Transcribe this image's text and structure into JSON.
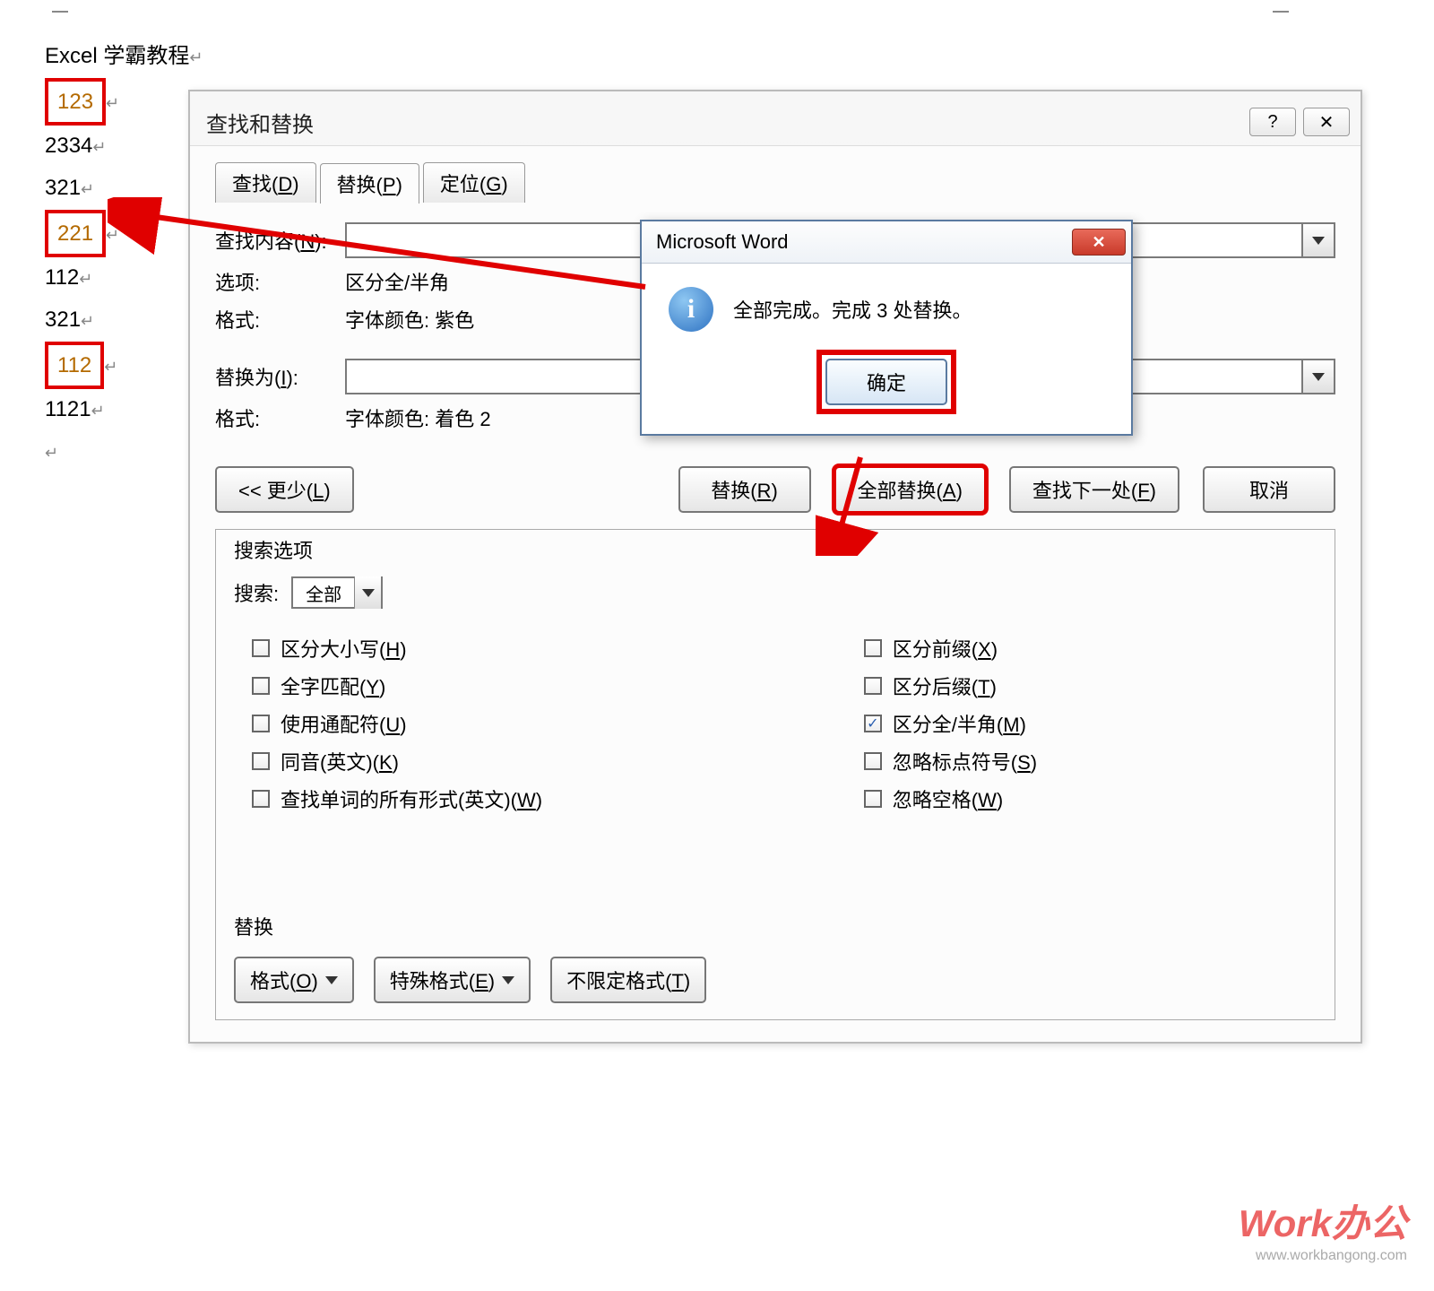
{
  "doc": {
    "title": "Excel 学霸教程",
    "lines": [
      "123",
      "2334",
      "321",
      "221",
      "112",
      "321",
      "112",
      "1121"
    ],
    "highlighted_indices": [
      0,
      3,
      6
    ]
  },
  "dialog": {
    "title": "查找和替换",
    "help_glyph": "?",
    "close_glyph": "✕",
    "tabs": {
      "find": "查找(D)",
      "replace": "替换(P)",
      "goto": "定位(G)"
    },
    "find_label": "查找内容(N):",
    "options_label": "选项:",
    "options_value": "区分全/半角",
    "format_label": "格式:",
    "find_format_value": "字体颜色: 紫色",
    "replace_label": "替换为(I):",
    "replace_format_value": "字体颜色: 着色 2",
    "buttons": {
      "less": "<< 更少(L)",
      "replace": "替换(R)",
      "replace_all": "全部替换(A)",
      "find_next": "查找下一处(F)",
      "cancel": "取消"
    },
    "search_opts_title": "搜索选项",
    "search_label": "搜索:",
    "search_value": "全部",
    "checks": {
      "match_case": "区分大小写(H)",
      "whole_word": "全字匹配(Y)",
      "wildcards": "使用通配符(U)",
      "sounds_like": "同音(英文)(K)",
      "word_forms": "查找单词的所有形式(英文)(W)",
      "prefix": "区分前缀(X)",
      "suffix": "区分后缀(T)",
      "full_half": "区分全/半角(M)",
      "ignore_punct": "忽略标点符号(S)",
      "ignore_space": "忽略空格(W)"
    },
    "replace_section_title": "替换",
    "bottom_buttons": {
      "format": "格式(O)",
      "special": "特殊格式(E)",
      "no_format": "不限定格式(T)"
    }
  },
  "msgbox": {
    "title": "Microsoft Word",
    "text": "全部完成。完成 3 处替换。",
    "ok": "确定",
    "close_glyph": "✕"
  },
  "watermark": {
    "main": "Work办公",
    "sub": "www.workbangong.com"
  }
}
